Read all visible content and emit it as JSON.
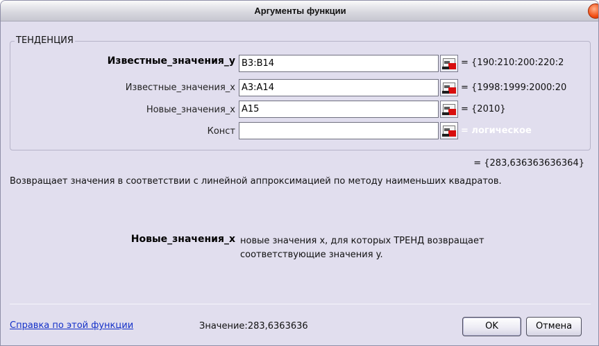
{
  "window": {
    "title": "Аргументы функции"
  },
  "function": {
    "name": "ТЕНДЕНЦИЯ",
    "args": [
      {
        "label": "Известные_значения_y",
        "value": "B3:B14",
        "result": "= {190:210:200:220:2",
        "bold": true
      },
      {
        "label": "Известные_значения_x",
        "value": "A3:A14",
        "result": "= {1998:1999:2000:20",
        "bold": false
      },
      {
        "label": "Новые_значения_x",
        "value": "A15",
        "result": "= {2010}",
        "bold": false
      },
      {
        "label": "Конст",
        "value": "",
        "result": "= логическое",
        "bold": false
      }
    ],
    "result": "= {283,636363636364}",
    "description": "Возвращает значения в соответствии с линейной аппроксимацией по методу наименьших квадратов."
  },
  "help": {
    "arg_name": "Новые_значения_x",
    "arg_text": "новые значения x, для которых ТРЕНД возвращает соответствующие значения y."
  },
  "footer": {
    "help_link": "Справка по этой функции",
    "value_label": "Значение:",
    "value": "283,6363636",
    "ok_label": "OK",
    "cancel_label": "Отмена"
  },
  "colors": {
    "dialog_bg": "#e1deee",
    "link": "#1330c8",
    "close_button": "#f24b10"
  },
  "icons": {
    "ref_button": "range-select-icon",
    "close": "close-icon"
  }
}
